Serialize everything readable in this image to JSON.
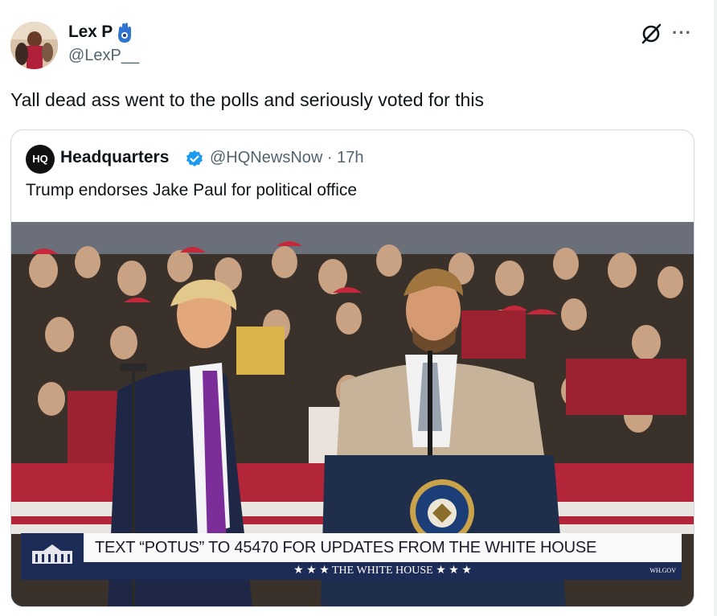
{
  "post": {
    "author_name": "Lex P",
    "author_handle": "@LexP__",
    "text": "Yall dead ass went to the polls and seriously voted for this",
    "more_label": "···"
  },
  "quoted": {
    "avatar_text": "HQ",
    "author_name": "Headquarters",
    "meta": "@HQNewsNow · 17h",
    "text": "Trump endorses Jake Paul for political office",
    "chyron_main": "TEXT “POTUS” TO 45470 FOR UPDATES FROM THE WHITE HOUSE",
    "chyron_sub": "★ ★ ★   THE WHITE HOUSE   ★ ★ ★",
    "chyron_tag": "WH.GOV"
  },
  "colors": {
    "verified_blue": "#1d9bf0",
    "hamsa_blue": "#2e74d0",
    "chyron_navy": "#1d2b57"
  },
  "icons": {
    "verified": "verified-badge-icon",
    "hamsa": "hamsa-emoji-icon",
    "grok": "grok-icon",
    "more": "more-horizontal-icon"
  }
}
